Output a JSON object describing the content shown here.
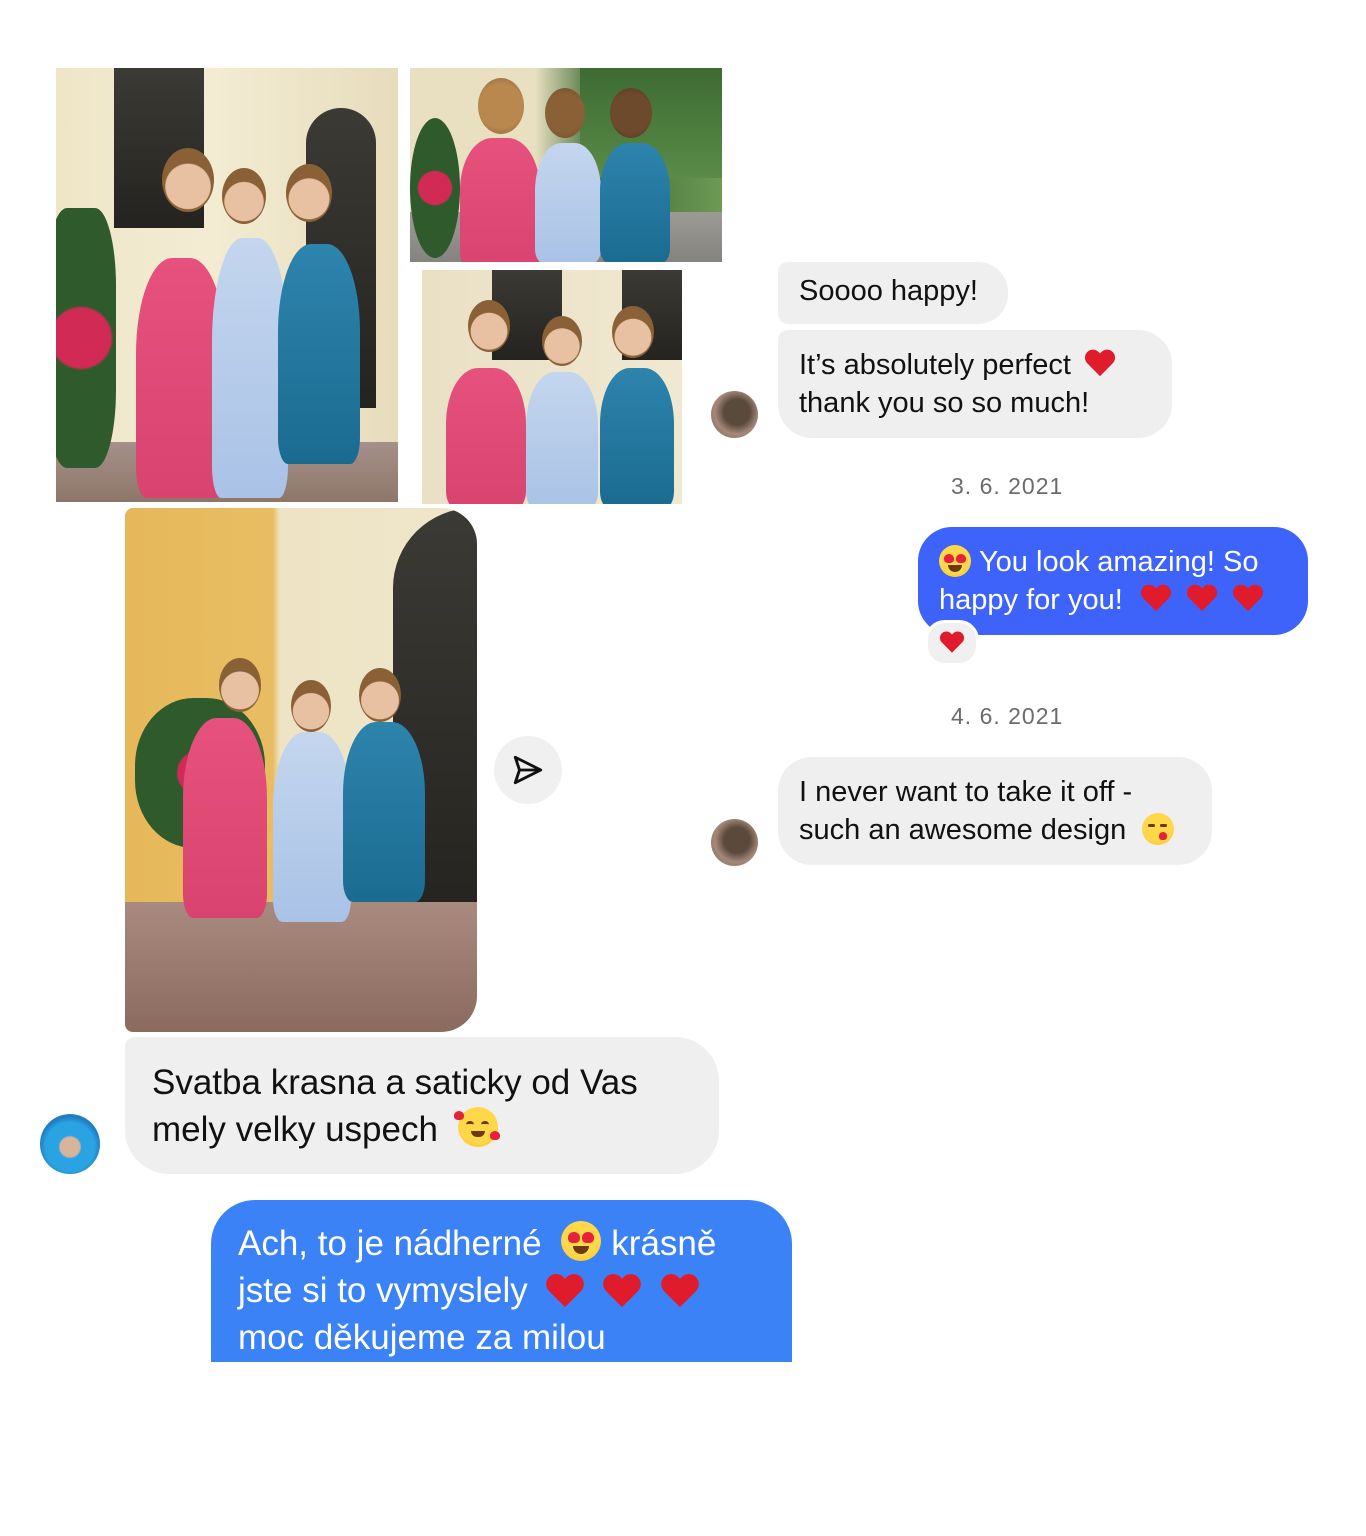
{
  "thread": {
    "messages": [
      {
        "id": "m1",
        "lines": [
          "Soooo happy!"
        ]
      },
      {
        "id": "m2",
        "lines": [
          "It’s absolutely perfect",
          "thank you so so much!"
        ]
      },
      {
        "id": "m3",
        "lines": [
          "You look amazing! So",
          "happy for you!"
        ]
      },
      {
        "id": "m4",
        "lines": [
          "I never want to take it off -",
          "such an awesome design"
        ]
      },
      {
        "id": "m5",
        "lines": [
          "Svatba krasna a saticky od Vas",
          "mely velky uspech"
        ]
      },
      {
        "id": "m6",
        "lines": [
          "Ach, to je nádherné",
          "krásně",
          "jste si to vymyslely",
          "moc děkujeme za milou"
        ]
      }
    ],
    "timestamps": [
      "3. 6. 2021",
      "4. 6. 2021"
    ],
    "reaction": "heart",
    "icons": {
      "share": "paper-plane-icon",
      "heart": "red-heart-emoji",
      "heart_eyes": "heart-eyes-emoji",
      "kiss": "face-blowing-kiss-emoji",
      "hearts_face": "smiling-face-with-hearts-emoji"
    }
  },
  "colors": {
    "incoming_bubble": "#efefef",
    "outgoing_bubble": "#3d63fa",
    "outgoing_bubble_alt": "#3a82f6"
  }
}
